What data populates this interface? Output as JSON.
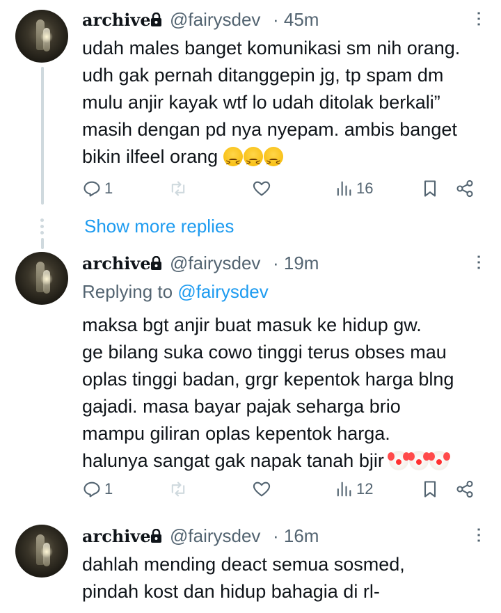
{
  "tweets": [
    {
      "author": "archive",
      "handle": "@fairysdev",
      "time": "· 45m",
      "text": "udah males banget komunikasi sm nih orang.\nudh gak pernah ditanggepin jg, tp spam dm\nmulu anjir kayak wtf lo udah ditolak berkali”\nmasih dengan pd nya nyepam. ambis banget\nbikin ilfeel orang",
      "emojis": [
        "confounded-face",
        "confounded-face",
        "confounded-face"
      ],
      "replies": "1",
      "retweets": "",
      "likes": "",
      "views": "16"
    },
    {
      "author": "archive",
      "handle": "@fairysdev",
      "time": "· 19m",
      "replying_prefix": "Replying to",
      "replying_to": "@fairysdev",
      "text": "maksa bgt anjir buat masuk ke hidup gw.\nge bilang suka cowo tinggi terus obses mau\noplas tinggi badan, grgr kepentok harga blng\ngajadi. masa bayar pajak seharga brio\nmampu giliran oplas kepentok harga.\nhalunya sangat gak napak tanah bjir",
      "emojis": [
        "clown-face",
        "clown-face",
        "clown-face"
      ],
      "replies": "1",
      "retweets": "",
      "likes": "",
      "views": "12"
    },
    {
      "author": "archive",
      "handle": "@fairysdev",
      "time": "· 16m",
      "text": "dahlah mending deact semua sosmed,\npindah kost dan hidup bahagia di rl-"
    }
  ],
  "show_more_replies": "Show more replies",
  "colors": {
    "accent": "#1d9bf0",
    "secondary": "#536471",
    "text": "#0f1419",
    "thread": "#cfd9de"
  }
}
